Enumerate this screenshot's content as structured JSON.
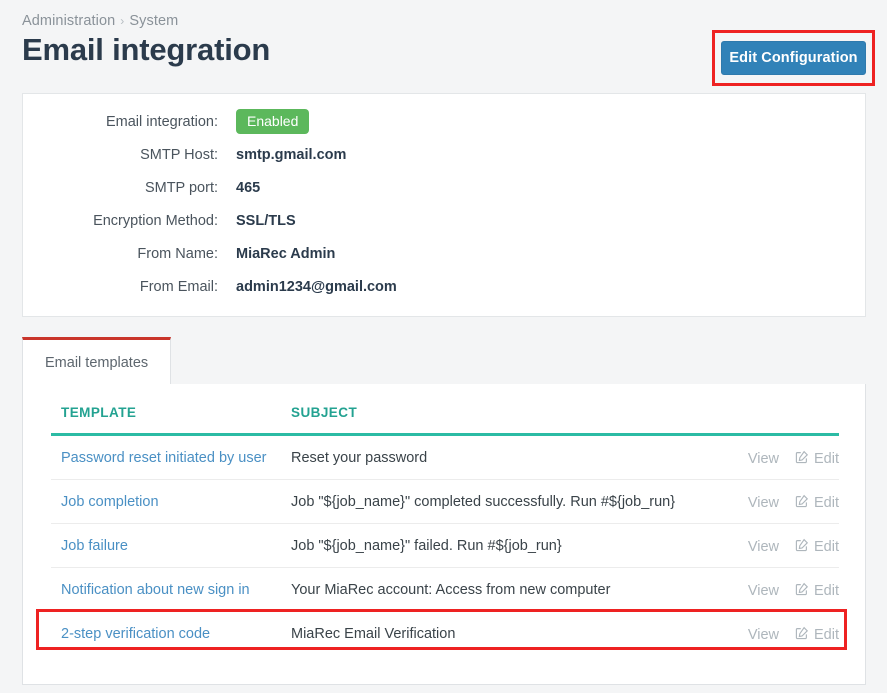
{
  "breadcrumb": {
    "items": [
      "Administration",
      "System"
    ],
    "separator": "›"
  },
  "header": {
    "title": "Email integration",
    "edit_button_label": "Edit Configuration"
  },
  "colors": {
    "accent_teal": "#2bbba4",
    "link_blue": "#4a90c4",
    "button_blue": "#3182b8",
    "badge_green": "#5cb85c",
    "annotation_red": "#ee2222",
    "tab_top_red": "#c9352b"
  },
  "configuration": {
    "rows": [
      {
        "label": "Email integration:",
        "value": "Enabled",
        "type": "badge"
      },
      {
        "label": "SMTP Host:",
        "value": "smtp.gmail.com",
        "type": "text"
      },
      {
        "label": "SMTP port:",
        "value": "465",
        "type": "text"
      },
      {
        "label": "Encryption Method:",
        "value": "SSL/TLS",
        "type": "text"
      },
      {
        "label": "From Name:",
        "value": "MiaRec Admin",
        "type": "text"
      },
      {
        "label": "From Email:",
        "value": "admin1234@gmail.com",
        "type": "text"
      }
    ]
  },
  "tabs": [
    {
      "label": "Email templates",
      "active": true
    }
  ],
  "templates_table": {
    "columns": [
      "TEMPLATE",
      "SUBJECT",
      ""
    ],
    "actions": {
      "view_label": "View",
      "edit_label": "Edit",
      "edit_icon": "pen-to-square-icon"
    },
    "rows": [
      {
        "template": "Password reset initiated by user",
        "subject": "Reset your password",
        "highlighted": false
      },
      {
        "template": "Job completion",
        "subject": "Job \"${job_name}\" completed successfully. Run #${job_run}",
        "highlighted": false
      },
      {
        "template": "Job failure",
        "subject": "Job \"${job_name}\" failed. Run #${job_run}",
        "highlighted": false
      },
      {
        "template": "Notification about new sign in",
        "subject": "Your MiaRec account: Access from new computer",
        "highlighted": false
      },
      {
        "template": "2-step verification code",
        "subject": "MiaRec Email Verification",
        "highlighted": true
      }
    ]
  }
}
